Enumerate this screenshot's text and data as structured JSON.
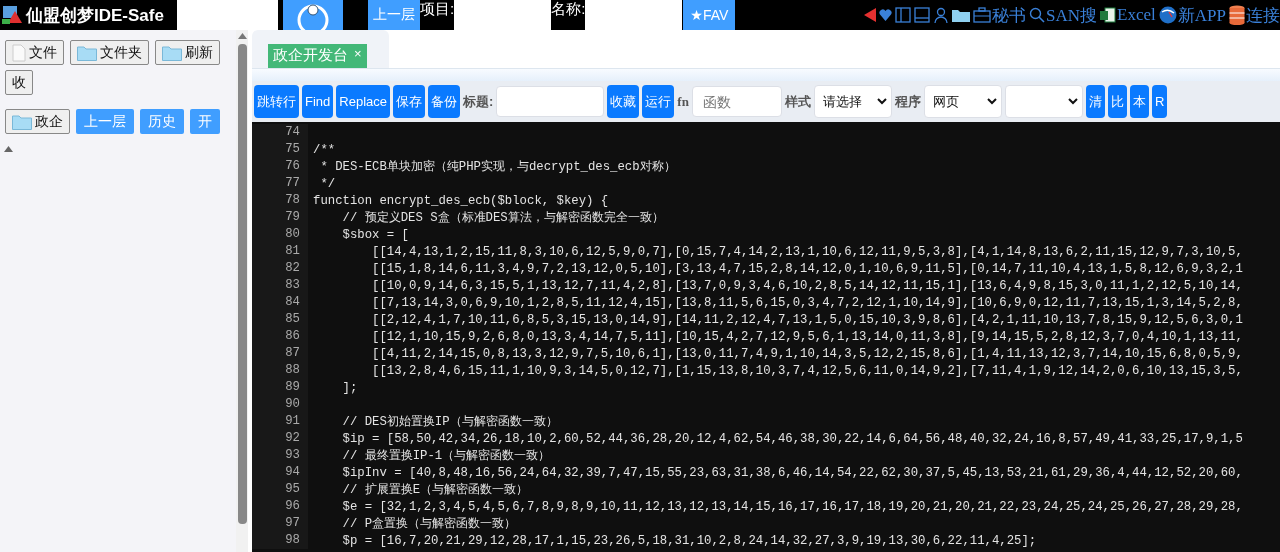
{
  "top_bar": {
    "title": "仙盟创梦IDE-Safe",
    "up_button": "上一层",
    "project_label": "项目:",
    "name_label": "名称:",
    "fav_button": "★FAV",
    "links": [
      {
        "kind": "triangle"
      },
      {
        "kind": "heart"
      },
      {
        "kind": "panel-left"
      },
      {
        "kind": "panel-bottom"
      },
      {
        "kind": "user"
      },
      {
        "kind": "folder"
      },
      {
        "kind": "case",
        "label": "秘书"
      },
      {
        "kind": "search",
        "label": "SAN搜"
      },
      {
        "kind": "excel",
        "label": "Excel"
      },
      {
        "kind": "globe",
        "label": "新APP"
      },
      {
        "kind": "database",
        "label": "连接"
      }
    ]
  },
  "sidebar": {
    "file_buttons": [
      {
        "kind": "file",
        "label": "文件"
      },
      {
        "kind": "folder",
        "label": "文件夹"
      },
      {
        "kind": "folder",
        "label": "刷新"
      },
      {
        "kind": "plain",
        "label": "收"
      }
    ],
    "folder_button": "政企",
    "nav_buttons": [
      "上一层",
      "历史",
      "开"
    ]
  },
  "tabs": [
    {
      "label": "政企开发台",
      "close": "×",
      "selected": true
    }
  ],
  "toolbar": [
    {
      "kind": "button",
      "label": "跳转行"
    },
    {
      "kind": "button",
      "label": "Find"
    },
    {
      "kind": "button",
      "label": "Replace"
    },
    {
      "kind": "button",
      "label": "保存"
    },
    {
      "kind": "button",
      "label": "备份"
    },
    {
      "kind": "label",
      "label": "标题:"
    },
    {
      "kind": "input"
    },
    {
      "kind": "button",
      "label": "收藏"
    },
    {
      "kind": "button",
      "label": "运行"
    },
    {
      "kind": "label-bold",
      "label": "fn"
    },
    {
      "kind": "input",
      "placeholder": "函数"
    },
    {
      "kind": "label",
      "label": "样式"
    },
    {
      "kind": "select",
      "value": "请选择"
    },
    {
      "kind": "label",
      "label": "程序"
    },
    {
      "kind": "select",
      "value": "网页"
    },
    {
      "kind": "select"
    },
    {
      "kind": "button",
      "label": "清"
    },
    {
      "kind": "button",
      "label": "比"
    },
    {
      "kind": "button",
      "label": "本"
    },
    {
      "kind": "button",
      "label": "R"
    }
  ],
  "code": [
    {
      "number": "74"
    },
    {
      "number": "75",
      "text": "/**"
    },
    {
      "number": "76",
      "text": " * DES-ECB单块加密（纯PHP实现，与decrypt_des_ecb对称）"
    },
    {
      "number": "77",
      "text": " */"
    },
    {
      "number": "78",
      "text": "function encrypt_des_ecb($block, $key) {"
    },
    {
      "number": "79",
      "text": "    // 预定义DES S盒（标准DES算法，与解密函数完全一致）"
    },
    {
      "number": "80",
      "text": "    $sbox = ["
    },
    {
      "number": "81",
      "text": "        [[14,4,13,1,2,15,11,8,3,10,6,12,5,9,0,7],[0,15,7,4,14,2,13,1,10,6,12,11,9,5,3,8],[4,1,14,8,13,6,2,11,15,12,9,7,3,10,5,"
    },
    {
      "number": "82",
      "text": "        [[15,1,8,14,6,11,3,4,9,7,2,13,12,0,5,10],[3,13,4,7,15,2,8,14,12,0,1,10,6,9,11,5],[0,14,7,11,10,4,13,1,5,8,12,6,9,3,2,1"
    },
    {
      "number": "83",
      "text": "        [[10,0,9,14,6,3,15,5,1,13,12,7,11,4,2,8],[13,7,0,9,3,4,6,10,2,8,5,14,12,11,15,1],[13,6,4,9,8,15,3,0,11,1,2,12,5,10,14,"
    },
    {
      "number": "84",
      "text": "        [[7,13,14,3,0,6,9,10,1,2,8,5,11,12,4,15],[13,8,11,5,6,15,0,3,4,7,2,12,1,10,14,9],[10,6,9,0,12,11,7,13,15,1,3,14,5,2,8,"
    },
    {
      "number": "85",
      "text": "        [[2,12,4,1,7,10,11,6,8,5,3,15,13,0,14,9],[14,11,2,12,4,7,13,1,5,0,15,10,3,9,8,6],[4,2,1,11,10,13,7,8,15,9,12,5,6,3,0,1"
    },
    {
      "number": "86",
      "text": "        [[12,1,10,15,9,2,6,8,0,13,3,4,14,7,5,11],[10,15,4,2,7,12,9,5,6,1,13,14,0,11,3,8],[9,14,15,5,2,8,12,3,7,0,4,10,1,13,11,"
    },
    {
      "number": "87",
      "text": "        [[4,11,2,14,15,0,8,13,3,12,9,7,5,10,6,1],[13,0,11,7,4,9,1,10,14,3,5,12,2,15,8,6],[1,4,11,13,12,3,7,14,10,15,6,8,0,5,9,"
    },
    {
      "number": "88",
      "text": "        [[13,2,8,4,6,15,11,1,10,9,3,14,5,0,12,7],[1,15,13,8,10,3,7,4,12,5,6,11,0,14,9,2],[7,11,4,1,9,12,14,2,0,6,10,13,15,3,5,"
    },
    {
      "number": "89",
      "text": "    ];"
    },
    {
      "number": "90"
    },
    {
      "number": "91",
      "text": "    // DES初始置换IP（与解密函数一致）"
    },
    {
      "number": "92",
      "text": "    $ip = [58,50,42,34,26,18,10,2,60,52,44,36,28,20,12,4,62,54,46,38,30,22,14,6,64,56,48,40,32,24,16,8,57,49,41,33,25,17,9,1,5"
    },
    {
      "number": "93",
      "text": "    // 最终置换IP-1（与解密函数一致）"
    },
    {
      "number": "94",
      "text": "    $ipInv = [40,8,48,16,56,24,64,32,39,7,47,15,55,23,63,31,38,6,46,14,54,22,62,30,37,5,45,13,53,21,61,29,36,4,44,12,52,20,60,"
    },
    {
      "number": "95",
      "text": "    // 扩展置换E（与解密函数一致）"
    },
    {
      "number": "96",
      "text": "    $e = [32,1,2,3,4,5,4,5,6,7,8,9,8,9,10,11,12,13,12,13,14,15,16,17,16,17,18,19,20,21,20,21,22,23,24,25,24,25,26,27,28,29,28,"
    },
    {
      "number": "97",
      "text": "    // P盒置换（与解密函数一致）"
    },
    {
      "number": "98",
      "text": "    $p = [16,7,20,21,29,12,28,17,1,15,23,26,5,18,31,10,2,8,24,14,32,27,3,9,19,13,30,6,22,11,4,25];"
    }
  ]
}
